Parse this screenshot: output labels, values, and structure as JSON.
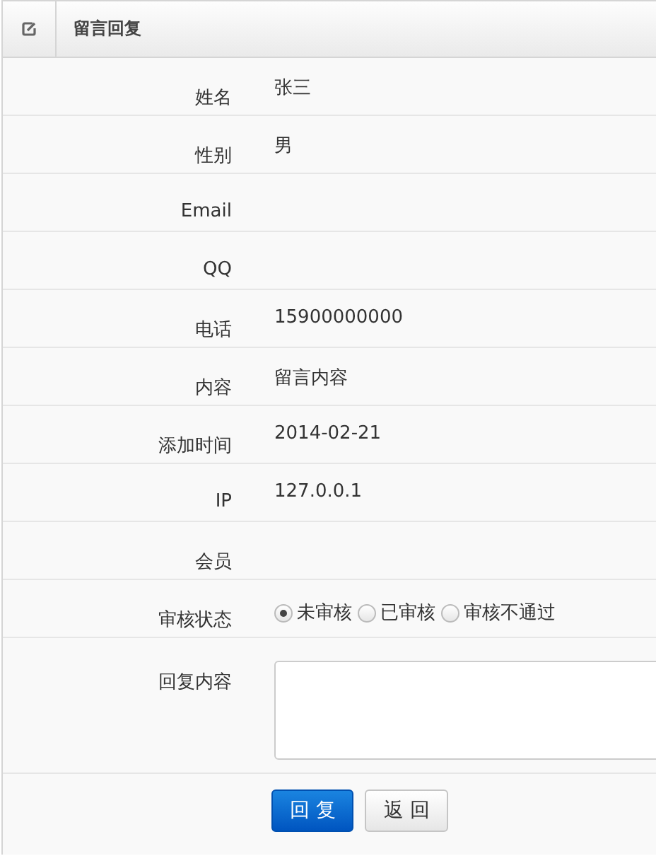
{
  "panel": {
    "title": "留言回复"
  },
  "fields": [
    {
      "kind": "text",
      "label": "姓名",
      "value": "张三"
    },
    {
      "kind": "text",
      "label": "性别",
      "value": "男"
    },
    {
      "kind": "text",
      "label": "Email"
    },
    {
      "kind": "text",
      "label": "QQ"
    },
    {
      "kind": "text",
      "label": "电话",
      "value": "15900000000"
    },
    {
      "kind": "text",
      "label": "内容",
      "value": "留言内容"
    },
    {
      "kind": "text",
      "label": "添加时间",
      "value": "2014-02-21"
    },
    {
      "kind": "text",
      "label": "IP",
      "value": "127.0.0.1"
    },
    {
      "kind": "text",
      "label": "会员"
    },
    {
      "kind": "radio",
      "label": "审核状态",
      "options": [
        {
          "label": "未审核",
          "selected": true
        },
        {
          "label": "已审核",
          "selected": false
        },
        {
          "label": "审核不通过",
          "selected": false
        }
      ]
    },
    {
      "kind": "textarea",
      "label": "回复内容"
    }
  ],
  "buttons": [
    {
      "label": "回 复",
      "kind": "primary"
    },
    {
      "label": "返 回",
      "kind": "default"
    }
  ]
}
